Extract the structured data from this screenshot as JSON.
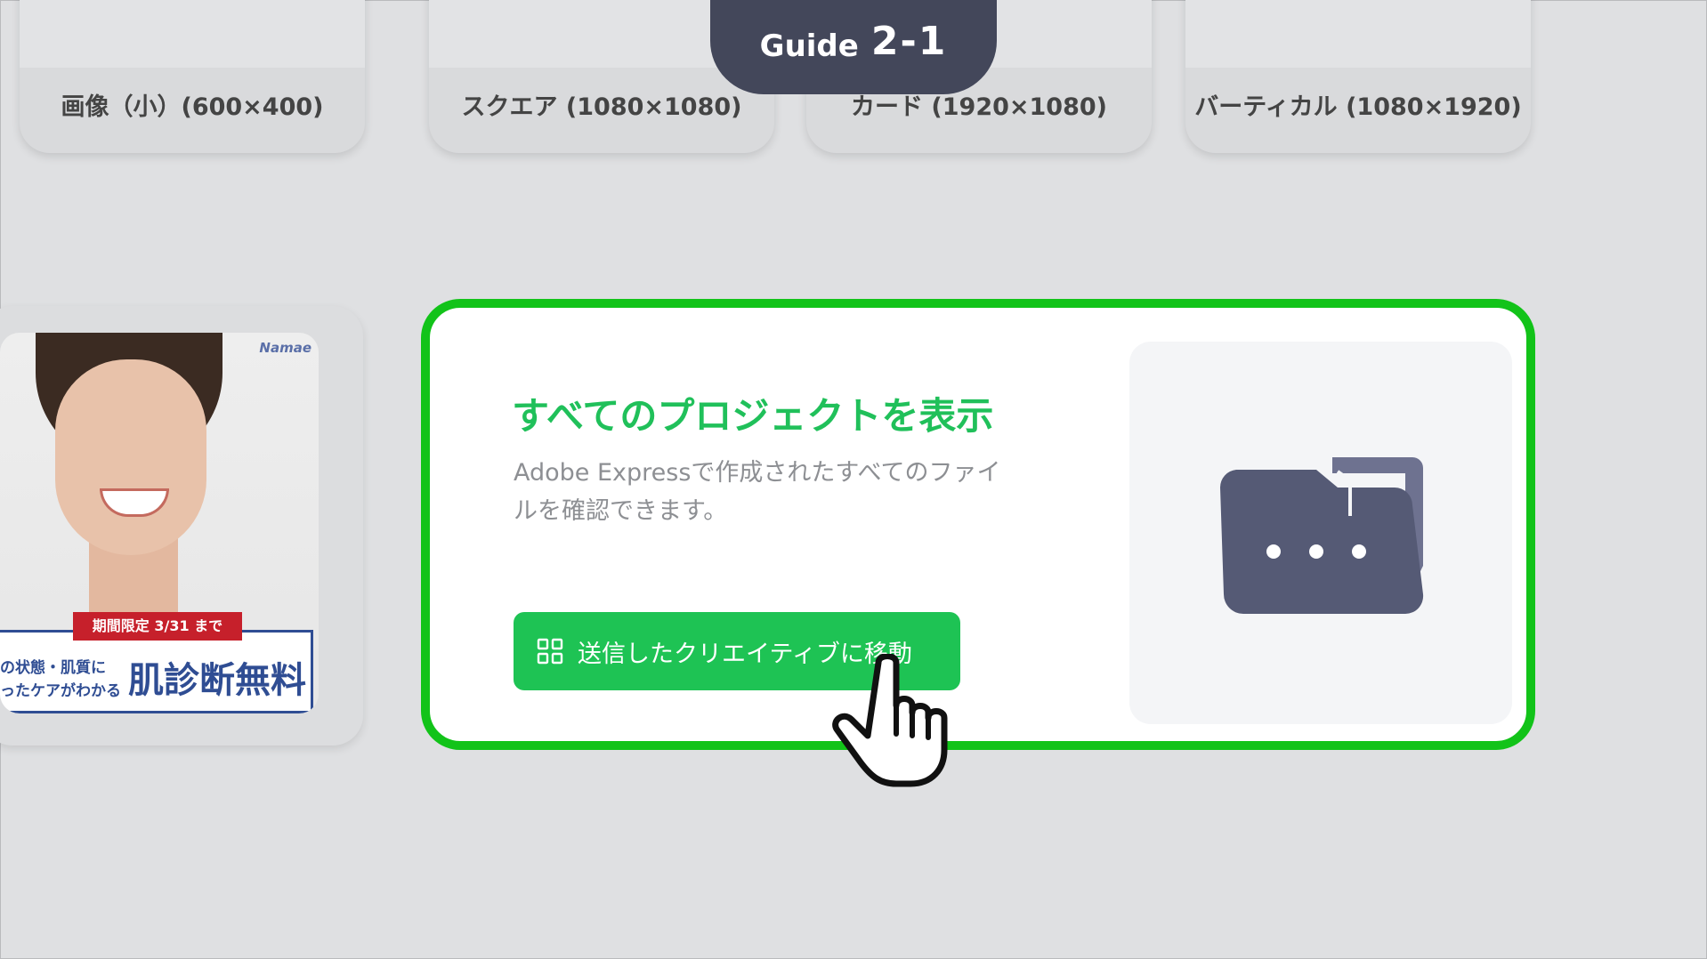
{
  "top_cards": [
    {
      "label": "画像（小）(600×400)"
    },
    {
      "label": "スクエア (1080×1080)"
    },
    {
      "label": "カード (1920×1080)"
    },
    {
      "label": "バーティカル (1080×1920)"
    }
  ],
  "guide": {
    "word": "Guide",
    "number": "2-1",
    "color": "#43475a"
  },
  "ad_card": {
    "brand": "Namae",
    "ribbon": "期間限定 3/31 まで",
    "sub_line1": "の状態・肌質に",
    "sub_line2": "ったケアがわかる",
    "headline": "肌診断無料"
  },
  "project_card": {
    "title": "すべてのプロジェクトを表示",
    "description": "Adobe Expressで作成されたすべてのファイルを確認できます。",
    "button_label": "送信したクリエイティブに移動",
    "button_icon": "grid-icon",
    "illustration_icon": "folder-icon",
    "highlight_color": "#12c319",
    "accent_color": "#20c05a"
  },
  "pointer": {
    "icon": "hand-pointer-icon"
  }
}
